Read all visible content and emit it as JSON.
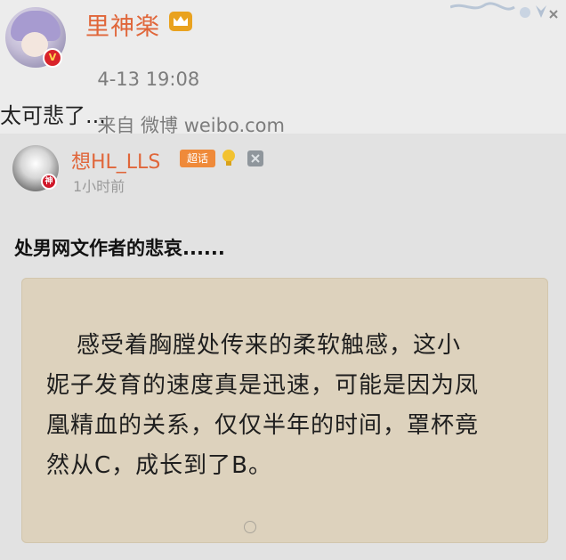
{
  "post": {
    "username": "里神楽",
    "time": "4-13 19:08",
    "source": "来自 微博 weibo.com",
    "text": "太可悲了..."
  },
  "repost": {
    "username": "想HL_LLS",
    "badge": "超话",
    "time": "1小时前",
    "text": "处男网文作者的悲哀......"
  },
  "image_text": {
    "line1": "感受着胸膛处传来的柔软触感，这小",
    "line2": "妮子发育的速度真是迅速，可能是因为凤",
    "line3": "凰精血的关系，仅仅半年的时间，罩杯竟",
    "line4": "然从C，成长到了B。"
  },
  "colors": {
    "name": "#e0663a",
    "background": "#ececec",
    "card": "#e2e2e2",
    "panel": "#ddd2bd"
  }
}
